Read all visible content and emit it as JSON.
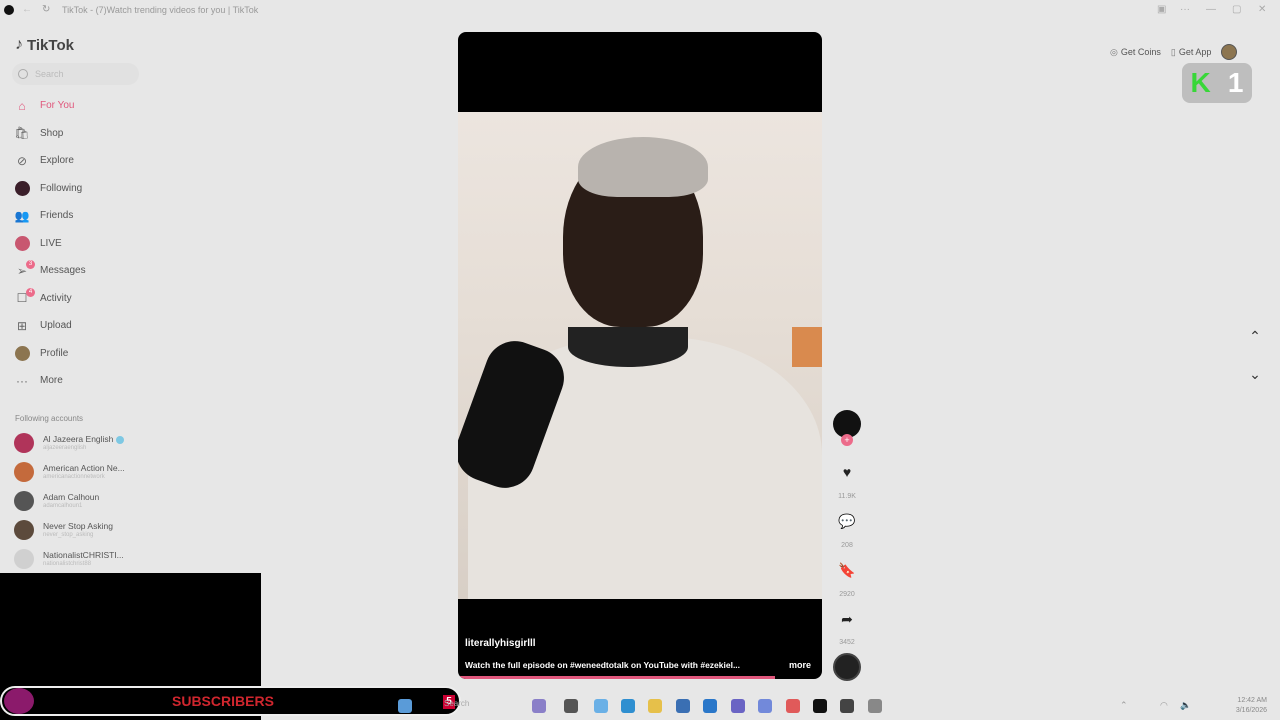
{
  "browser": {
    "title": "TikTok - (7)Watch trending videos for you | TikTok"
  },
  "sidebar": {
    "logo": "TikTok",
    "search_placeholder": "Search",
    "nav": [
      {
        "label": "For You",
        "icon": "home-icon",
        "active": true
      },
      {
        "label": "Shop",
        "icon": "shopping-bag-icon"
      },
      {
        "label": "Explore",
        "icon": "compass-icon"
      },
      {
        "label": "Following",
        "icon": "following-avatar-icon"
      },
      {
        "label": "Friends",
        "icon": "friends-icon"
      },
      {
        "label": "LIVE",
        "icon": "live-icon"
      },
      {
        "label": "Messages",
        "icon": "send-icon",
        "badge": "3"
      },
      {
        "label": "Activity",
        "icon": "chat-icon",
        "badge": "4"
      },
      {
        "label": "Upload",
        "icon": "plus-square-icon"
      },
      {
        "label": "Profile",
        "icon": "profile-avatar-icon"
      },
      {
        "label": "More",
        "icon": "ellipsis-icon"
      }
    ],
    "following_title": "Following accounts",
    "accounts": [
      {
        "name": "Al Jazeera English",
        "handle": "aljazeeraenglish",
        "verified": true
      },
      {
        "name": "American Action Ne...",
        "handle": "americanactionnetwork"
      },
      {
        "name": "Adam Calhoun",
        "handle": "adamcalhoun1"
      },
      {
        "name": "Never Stop Asking",
        "handle": "never_stop_asking"
      },
      {
        "name": "NationalistCHRISTI...",
        "handle": "nationalistchrist88"
      }
    ]
  },
  "video": {
    "username": "literallyhisgirlll",
    "caption": "Watch the full episode on #weneedtotalk on YouTube with #ezekiel...",
    "more_label": "more",
    "progress": 0.87
  },
  "actions": {
    "likes": "11.9K",
    "comments": "208",
    "bookmarks": "2920",
    "shares": "3452"
  },
  "topbar": {
    "get_coins": "Get Coins",
    "get_app": "Get App"
  },
  "k1": {
    "k": "K",
    "one": "1"
  },
  "overlay": {
    "subscribers": "SUBSCRIBERS",
    "count": "5"
  },
  "taskbar": {
    "search": "Search",
    "time": "12:42 AM",
    "date": "3/16/2026"
  },
  "colors": {
    "accent": "#e0577c",
    "background": "#e7e7e7"
  }
}
